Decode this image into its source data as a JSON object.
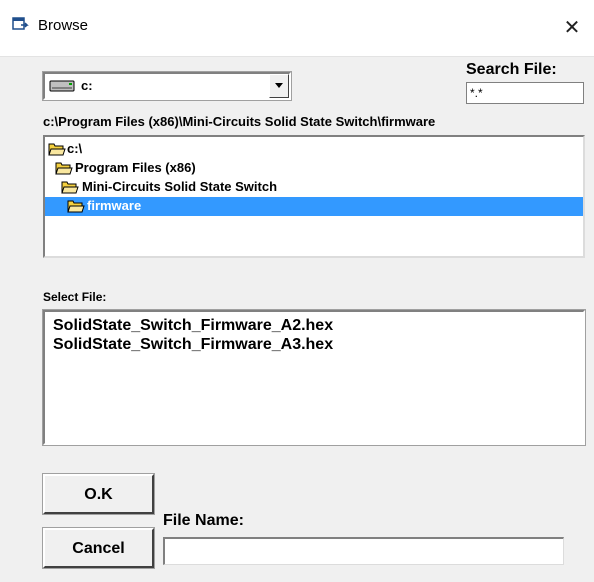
{
  "window": {
    "title": "Browse",
    "close_glyph": "✕"
  },
  "drive": {
    "value": "c:",
    "icon": "drive-icon"
  },
  "search": {
    "label": "Search File:",
    "value": "*.*"
  },
  "current_path": "c:\\Program Files (x86)\\Mini-Circuits Solid State Switch\\firmware",
  "directories": [
    {
      "label": "c:\\",
      "selected": false
    },
    {
      "label": "Program Files (x86)",
      "selected": false
    },
    {
      "label": "Mini-Circuits Solid State Switch",
      "selected": false
    },
    {
      "label": "firmware",
      "selected": true
    }
  ],
  "files": {
    "label": "Select File:",
    "items": [
      "SolidState_Switch_Firmware_A2.hex",
      "SolidState_Switch_Firmware_A3.hex"
    ]
  },
  "buttons": {
    "ok": "O.K",
    "cancel": "Cancel"
  },
  "filename": {
    "label": "File Name:",
    "value": ""
  },
  "colors": {
    "selection": "#3399ff",
    "folder": "#f4d03f"
  }
}
